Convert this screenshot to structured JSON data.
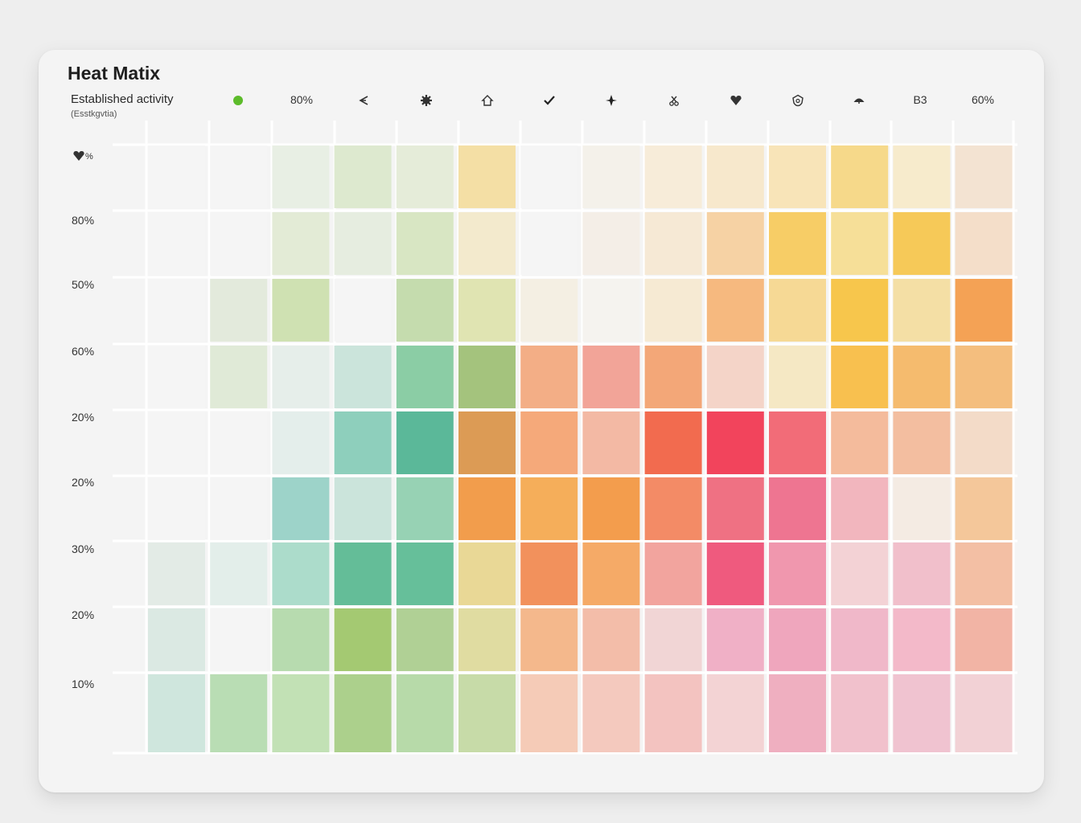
{
  "chart_data": {
    "type": "heatmap",
    "title": "Heat Matix",
    "subtitle": "Established activity",
    "subnote": "(Esstkgvtia)",
    "columns": [
      {
        "label": "",
        "icon": "green-dot-icon"
      },
      {
        "label": "80%",
        "icon": ""
      },
      {
        "label": "",
        "icon": "split-arrow-icon"
      },
      {
        "label": "",
        "icon": "gear-icon"
      },
      {
        "label": "",
        "icon": "home-icon"
      },
      {
        "label": "",
        "icon": "checkmark-icon"
      },
      {
        "label": "",
        "icon": "star-icon"
      },
      {
        "label": "",
        "icon": "scissors-icon"
      },
      {
        "label": "",
        "icon": "heart-icon"
      },
      {
        "label": "",
        "icon": "shield-icon"
      },
      {
        "label": "",
        "icon": "umbrella-icon"
      },
      {
        "label": "B3",
        "icon": ""
      },
      {
        "label": "60%",
        "icon": ""
      }
    ],
    "rows": [
      {
        "label": "%",
        "icon": "heart-icon"
      },
      {
        "label": "80%",
        "icon": ""
      },
      {
        "label": "50%",
        "icon": ""
      },
      {
        "label": "60%",
        "icon": ""
      },
      {
        "label": "20%",
        "icon": ""
      },
      {
        "label": "20%",
        "icon": ""
      },
      {
        "label": "30%",
        "icon": ""
      },
      {
        "label": "20%",
        "icon": ""
      },
      {
        "label": "10%",
        "icon": ""
      }
    ],
    "cells": [
      [
        "#f5f5f5",
        "#f5f5f5",
        "#e8efe4",
        "#dde9cf",
        "#e5ecd9",
        "#f4dfa5",
        "#f5f5f5",
        "#f4f1ea",
        "#f7ecd9",
        "#f7e8cc",
        "#f8e4b8",
        "#f6d98a",
        "#f7ebcc",
        "#f3e3d2"
      ],
      [
        "#f5f5f5",
        "#f5f5f5",
        "#e3ebd6",
        "#e6ede0",
        "#d8e6c3",
        "#f3eacd",
        "#f5f5f5",
        "#f4eee7",
        "#f6e9d5",
        "#f6d2a4",
        "#f7cd66",
        "#f6df98",
        "#f6c958",
        "#f4dec9"
      ],
      [
        "#f5f5f5",
        "#e3eadc",
        "#cfe1b2",
        "#f5f5f5",
        "#c5dcae",
        "#e0e4b2",
        "#f4efe3",
        "#f5f3ef",
        "#f6ead3",
        "#f6b97f",
        "#f6d995",
        "#f7c64c",
        "#f4dfa5",
        "#f4a255"
      ],
      [
        "#f5f5f5",
        "#e0ead7",
        "#e6eeea",
        "#cbe4db",
        "#8bcda5",
        "#a4c37d",
        "#f3ae86",
        "#f2a498",
        "#f3a778",
        "#f4d4c8",
        "#f5e8c4",
        "#f8c04f",
        "#f5bb6e",
        "#f4be7e"
      ],
      [
        "#f5f5f5",
        "#f5f5f5",
        "#e4eeeb",
        "#8ecfbc",
        "#5bb899",
        "#dc9b55",
        "#f5a97a",
        "#f3b9a4",
        "#f26b4f",
        "#f2445c",
        "#f26c78",
        "#f4bb9c",
        "#f3bea0",
        "#f3dbc8"
      ],
      [
        "#f5f5f5",
        "#f5f5f5",
        "#9dd3c9",
        "#cbe4db",
        "#97d2b4",
        "#f29d4c",
        "#f5ae5a",
        "#f39d4d",
        "#f38b66",
        "#ef7183",
        "#ee7591",
        "#f2b6be",
        "#f4ebe3",
        "#f4c79a"
      ],
      [
        "#e3ebe6",
        "#e3eeea",
        "#acdccb",
        "#64bd98",
        "#66bf9a",
        "#e9d896",
        "#f2915c",
        "#f5aa67",
        "#f2a49e",
        "#ef5a7e",
        "#f097ae",
        "#f3d2d5",
        "#f1bfcb",
        "#f3bfa4"
      ],
      [
        "#dbe9e3",
        "#f5f5f5",
        "#b7dbaf",
        "#a4c972",
        "#b0d095",
        "#e0dca1",
        "#f4b88c",
        "#f3bda9",
        "#f1d5d5",
        "#f0b0c6",
        "#efa6bd",
        "#f0b8c9",
        "#f3b9c9",
        "#f2b4a5"
      ],
      [
        "#cfe6dd",
        "#b9ddb4",
        "#c2e1b5",
        "#acd08c",
        "#b7daa9",
        "#c7dba8",
        "#f5cbb7",
        "#f4c9be",
        "#f3c3c0",
        "#f3d3d4",
        "#efafc0",
        "#f1c1cc",
        "#f0c3d0",
        "#f2d1d5"
      ]
    ]
  }
}
